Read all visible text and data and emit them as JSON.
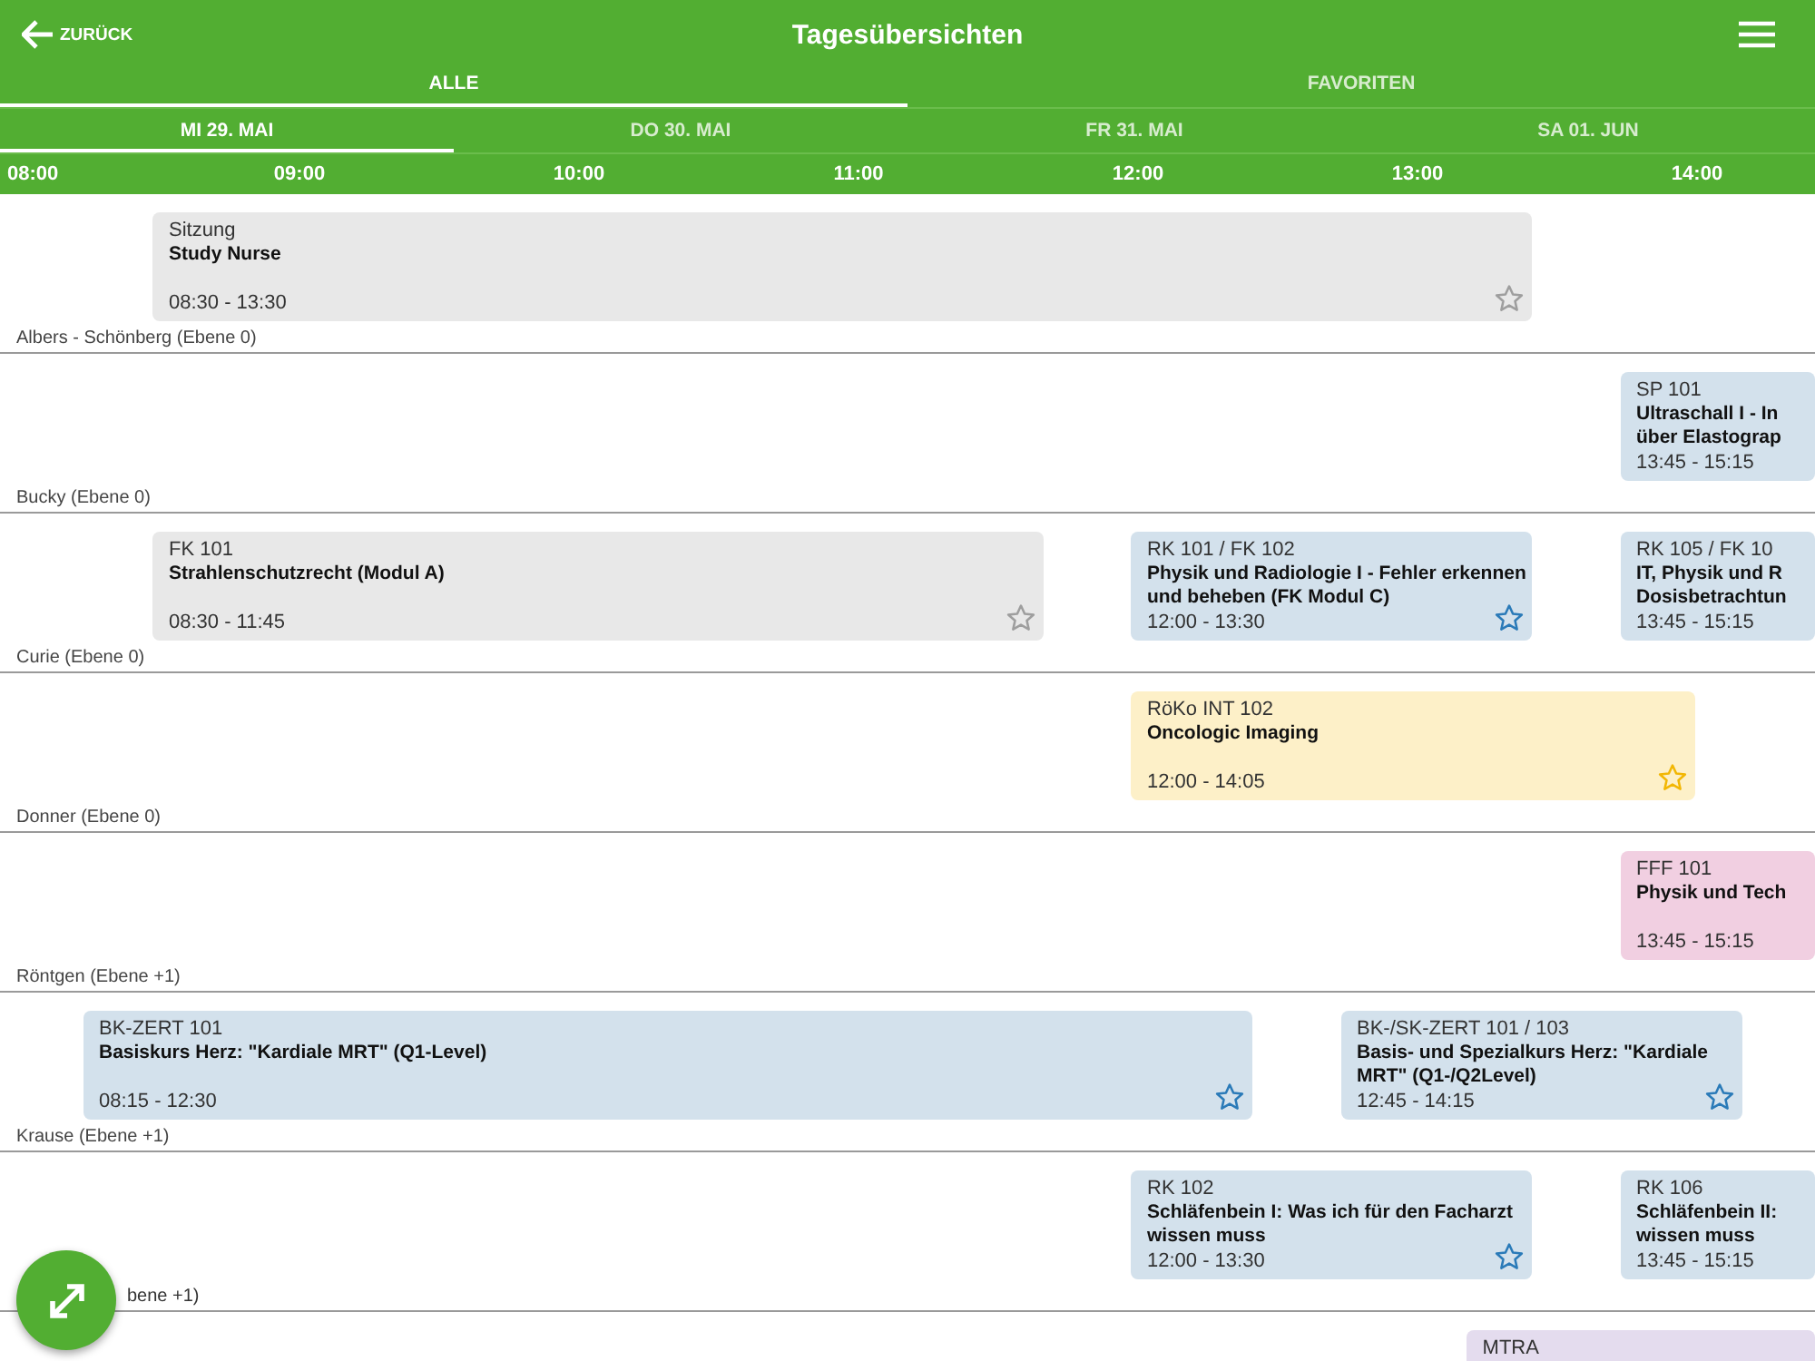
{
  "header": {
    "back": "ZURÜCK",
    "title": "Tagesübersichten"
  },
  "tabs": [
    {
      "label": "ALLE",
      "selected": true
    },
    {
      "label": "FAVORITEN",
      "selected": false
    }
  ],
  "days": [
    {
      "label": "MI 29. MAI",
      "selected": true
    },
    {
      "label": "DO 30. MAI",
      "selected": false
    },
    {
      "label": "FR 31. MAI",
      "selected": false
    },
    {
      "label": "SA 01. JUN",
      "selected": false
    }
  ],
  "hours": [
    "08:00",
    "09:00",
    "10:00",
    "11:00",
    "12:00",
    "13:00",
    "14:00"
  ],
  "rooms": [
    {
      "label": "Albers - Schönberg (Ebene 0)",
      "covered": false,
      "sessions": [
        {
          "kind": "sitzung",
          "code": "Sitzung",
          "title_lines": [
            "Study Nurse"
          ],
          "time": "08:30 - 13:30",
          "star": true
        }
      ]
    },
    {
      "label": "Bucky (Ebene 0)",
      "covered": false,
      "sessions": [
        {
          "kind": "kurs",
          "code": "SP 101",
          "title_lines": [
            "Ultraschall I - In",
            "über Elastograp"
          ],
          "time": "13:45 - 15:15",
          "star": false
        }
      ]
    },
    {
      "label": "Curie (Ebene 0)",
      "covered": false,
      "sessions": [
        {
          "kind": "sitzung",
          "code": "FK 101",
          "title_lines": [
            "Strahlenschutzrecht (Modul A)"
          ],
          "time": "08:30 - 11:45",
          "star": true
        },
        {
          "kind": "kurs",
          "code": "RK 101 / FK 102",
          "title_lines": [
            "Physik und Radiologie I - Fehler erkennen",
            "und beheben (FK Modul C)"
          ],
          "time": "12:00 - 13:30",
          "star": true
        },
        {
          "kind": "kurs",
          "code": "RK 105 / FK 10",
          "title_lines": [
            "IT, Physik und R",
            "Dosisbetrachtun"
          ],
          "time": "13:45 - 15:15",
          "star": false
        }
      ]
    },
    {
      "label": "Donner (Ebene 0)",
      "covered": false,
      "sessions": [
        {
          "kind": "roko",
          "code": "RöKo INT 102",
          "title_lines": [
            "Oncologic Imaging"
          ],
          "time": "12:00 - 14:05",
          "star": true
        }
      ]
    },
    {
      "label": "Röntgen (Ebene +1)",
      "covered": false,
      "sessions": [
        {
          "kind": "fff",
          "code": "FFF 101",
          "title_lines": [
            "Physik und Tech"
          ],
          "time": "13:45 - 15:15",
          "star": false
        }
      ]
    },
    {
      "label": "Krause (Ebene +1)",
      "covered": false,
      "sessions": [
        {
          "kind": "kurs",
          "code": "BK-ZERT 101",
          "title_lines": [
            "Basiskurs Herz: \"Kardiale MRT\" (Q1-Level)"
          ],
          "time": "08:15 - 12:30",
          "star": true
        },
        {
          "kind": "kurs",
          "code": "BK-/SK-ZERT 101 / 103",
          "title_lines": [
            "Basis- und Spezialkurs Herz: \"Kardiale",
            "MRT\" (Q1-/Q2Level)"
          ],
          "time": "12:45 - 14:15",
          "star": true
        }
      ]
    },
    {
      "label": "bene +1)",
      "covered": true,
      "sessions": [
        {
          "kind": "kurs",
          "code": "RK 102",
          "title_lines": [
            "Schläfenbein I: Was ich für den Facharzt",
            "wissen muss"
          ],
          "time": "12:00 - 13:30",
          "star": true
        },
        {
          "kind": "kurs",
          "code": "RK 106",
          "title_lines": [
            "Schläfenbein II:",
            "wissen muss"
          ],
          "time": "13:45 - 15:15",
          "star": false
        }
      ]
    },
    {
      "sessions": [
        {
          "kind": "mtra",
          "code": "MTRA",
          "star": false
        }
      ]
    }
  ]
}
